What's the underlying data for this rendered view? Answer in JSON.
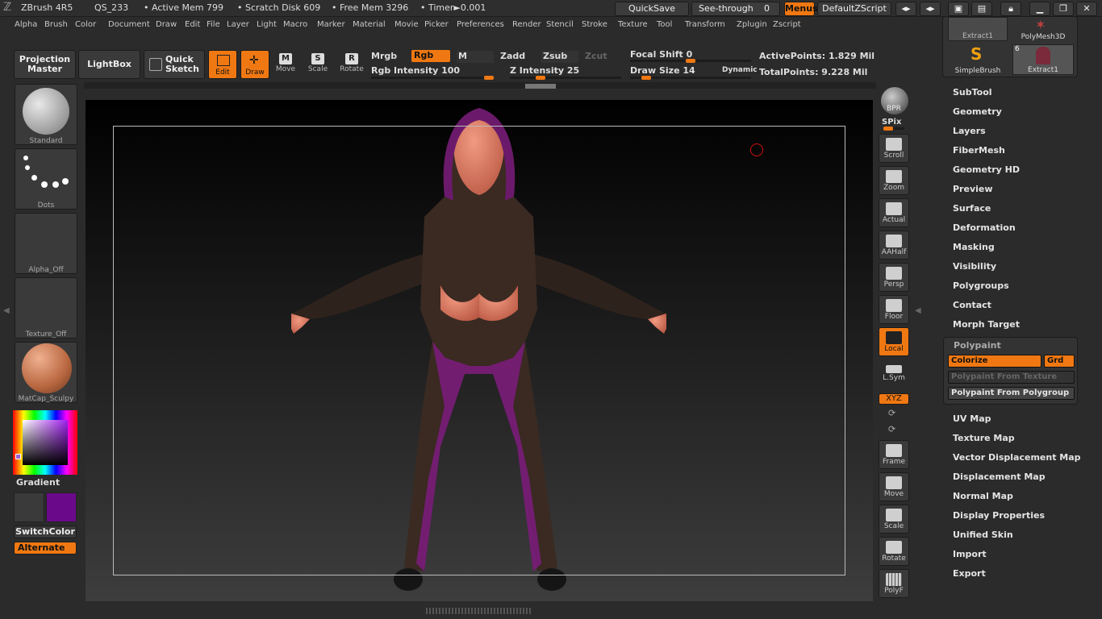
{
  "title": {
    "app": "ZBrush 4R5",
    "doc": "QS_233",
    "active_mem": "• Active Mem 799",
    "scratch": "• Scratch Disk 609",
    "free": "• Free Mem 3296",
    "timer": "• Timer►0.001"
  },
  "topbuttons": {
    "quicksave": "QuickSave",
    "seethrough": "See-through",
    "seethrough_value": "0",
    "menus": "Menus",
    "zscript": "DefaultZScript"
  },
  "menus": [
    "Alpha",
    "Brush",
    "Color",
    "Document",
    "Draw",
    "Edit",
    "File",
    "Layer",
    "Light",
    "Macro",
    "Marker",
    "Material",
    "Movie",
    "Picker",
    "Preferences",
    "Render",
    "Stencil",
    "Stroke",
    "Texture",
    "Tool",
    "Transform",
    "Zplugin",
    "Zscript"
  ],
  "toolbar": {
    "projection_master": "Projection Master",
    "lightbox": "LightBox",
    "quick_sketch": "Quick Sketch",
    "edit": "Edit",
    "draw": "Draw",
    "move": "Move",
    "scale": "Scale",
    "rotate": "Rotate",
    "mrgb": "Mrgb",
    "rgb": "Rgb",
    "m": "M",
    "zadd": "Zadd",
    "zsub": "Zsub",
    "zcut": "Zcut",
    "rgb_intensity": "Rgb Intensity 100",
    "z_intensity": "Z Intensity 25",
    "focal_shift": "Focal Shift 0",
    "draw_size": "Draw Size 14",
    "dynamic": "Dynamic",
    "active_points": "ActivePoints: 1.829 Mil",
    "total_points": "TotalPoints: 9.228 Mil"
  },
  "sliders": {
    "rgb_intensity": 1.0,
    "z_intensity": 0.25,
    "focal_shift": 0.5,
    "draw_size": 0.1
  },
  "leftpanel": {
    "brush": "Standard",
    "stroke": "Dots",
    "alpha": "Alpha_Off",
    "texture": "Texture_Off",
    "material": "MatCap_Sculpy",
    "gradient": "Gradient",
    "switch_color": "SwitchColor",
    "alternate": "Alternate"
  },
  "rightshelf": [
    "BPR",
    "SPix",
    "Scroll",
    "Zoom",
    "Actual",
    "AAHalf",
    "Persp",
    "Floor",
    "Local",
    "L.Sym",
    "XYZ",
    "Frame",
    "Move",
    "Scale",
    "Rotate",
    "PolyF"
  ],
  "tray": {
    "thumbs": [
      "Extract1",
      "PolyMesh3D",
      "SimpleBrush",
      "Extract1"
    ],
    "thumb_count": "6",
    "items": [
      "SubTool",
      "Geometry",
      "Layers",
      "FiberMesh",
      "Geometry HD",
      "Preview",
      "Surface",
      "Deformation",
      "Masking",
      "Visibility",
      "Polygroups",
      "Contact",
      "Morph Target"
    ],
    "polypaint": "Polypaint",
    "colorize": "Colorize",
    "grd": "Grd",
    "from_texture": "Polypaint From Texture",
    "from_polygroup": "Polypaint From Polygroup",
    "items2": [
      "UV Map",
      "Texture Map",
      "Vector Displacement Map",
      "Displacement Map",
      "Normal Map",
      "Display Properties",
      "Unified Skin",
      "Import",
      "Export"
    ]
  },
  "colors": {
    "accent": "#f07812",
    "main_color": "#3a3a3a",
    "secondary_color": "#6a0a8a",
    "skin": "#e07660",
    "suit": "#3a2a22",
    "suit_pattern": "#7a1c7a"
  }
}
